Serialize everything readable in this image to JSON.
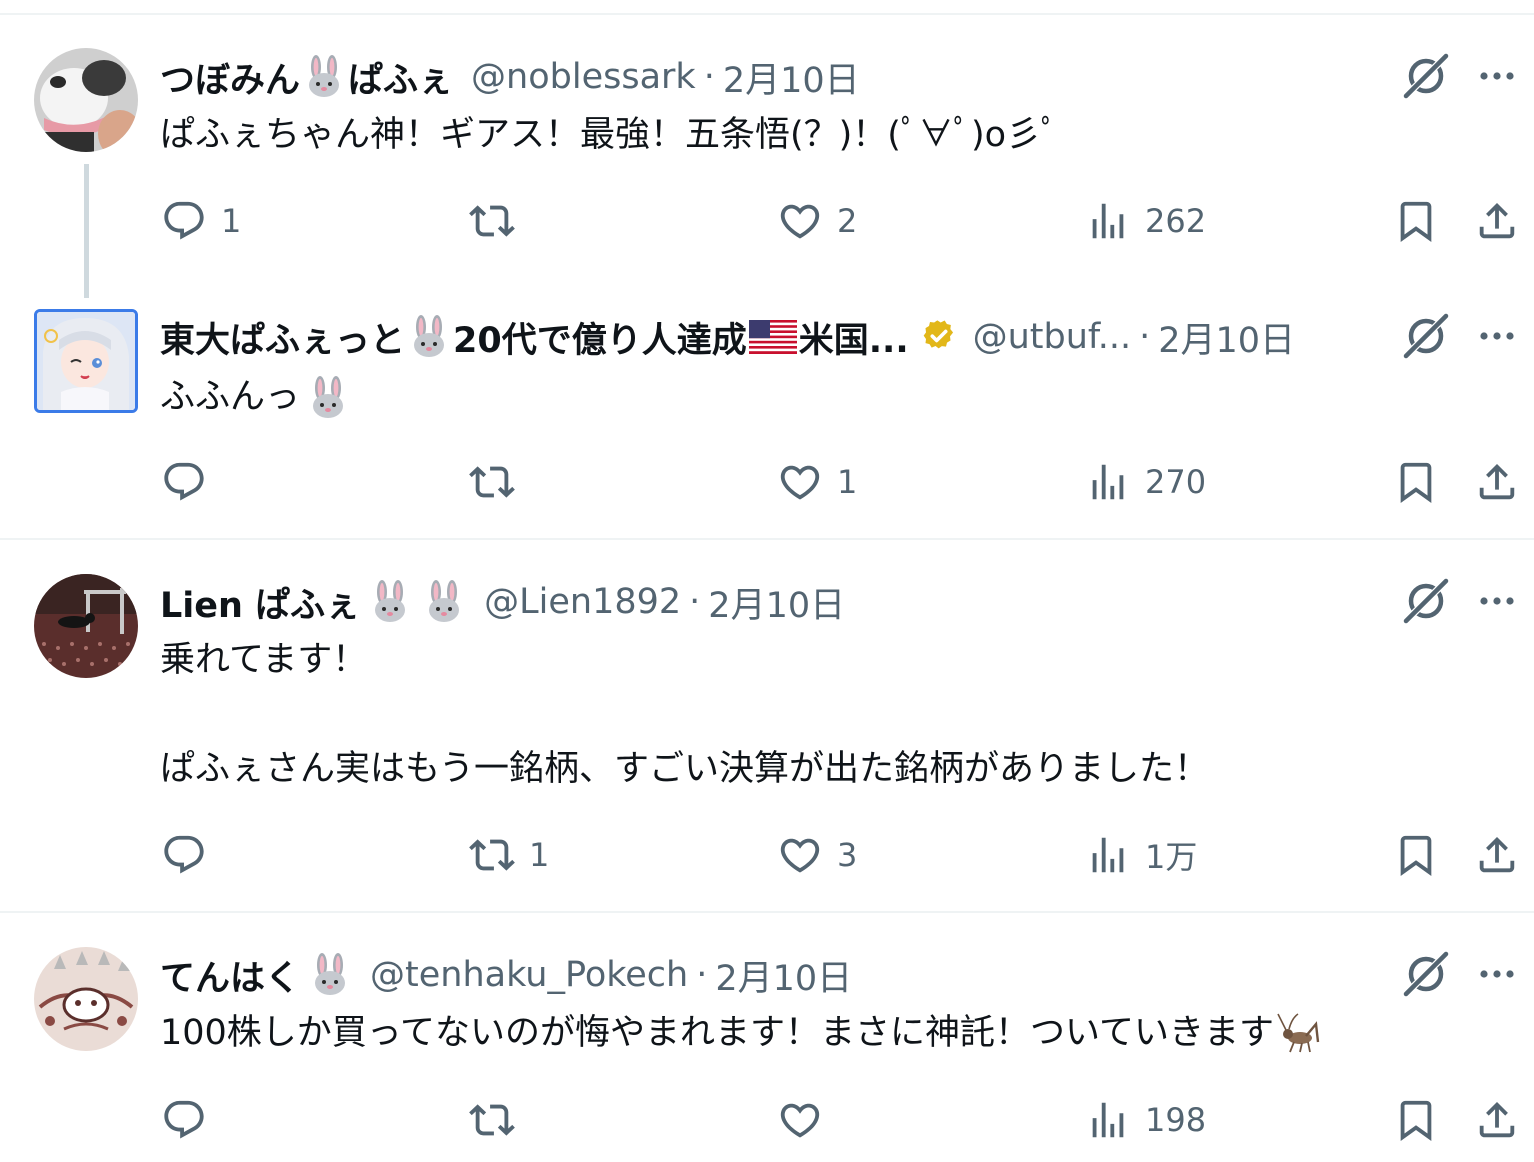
{
  "rabbit_emoji": "🐰",
  "tweets": [
    {
      "name_a": "つぼみん",
      "name_b": "ぱふぇ",
      "handle": "@noblessark",
      "dot": "·",
      "time": "2月10日",
      "text": "ぱふぇちゃん神！ギアス！最強！五条悟(？)！(ﾟ∀ﾟ)o彡ﾟ",
      "replies": "1",
      "retweets": "",
      "likes": "2",
      "views": "262"
    },
    {
      "name_a": "東大ぱふぇっと",
      "name_b": "20代で億り人達成",
      "name_c": "米国...",
      "handle": "@utbuf...",
      "dot": "·",
      "time": "2月10日",
      "text": "ふふんっ",
      "replies": "",
      "retweets": "",
      "likes": "1",
      "views": "270"
    },
    {
      "name_a": "Lien ぱふぇ",
      "handle": "@Lien1892",
      "dot": "·",
      "time": "2月10日",
      "text_line1": "乗れてます！",
      "text_line2": "ぱふぇさん実はもう一銘柄、すごい決算が出た銘柄がありました！",
      "replies": "",
      "retweets": "1",
      "likes": "3",
      "views": "1万"
    },
    {
      "name_a": "てんはく",
      "handle": "@tenhaku_Pokech",
      "dot": "·",
      "time": "2月10日",
      "text": "100株しか買ってないのが悔やまれます！まさに神託！ついていきます",
      "replies": "",
      "retweets": "",
      "likes": "",
      "views": "198"
    }
  ],
  "colors": {
    "text_primary": "#0f1419",
    "text_secondary": "#536471",
    "divider": "#eff3f4",
    "thread_line": "#cfd9de",
    "verified_gold": "#e2b719"
  }
}
